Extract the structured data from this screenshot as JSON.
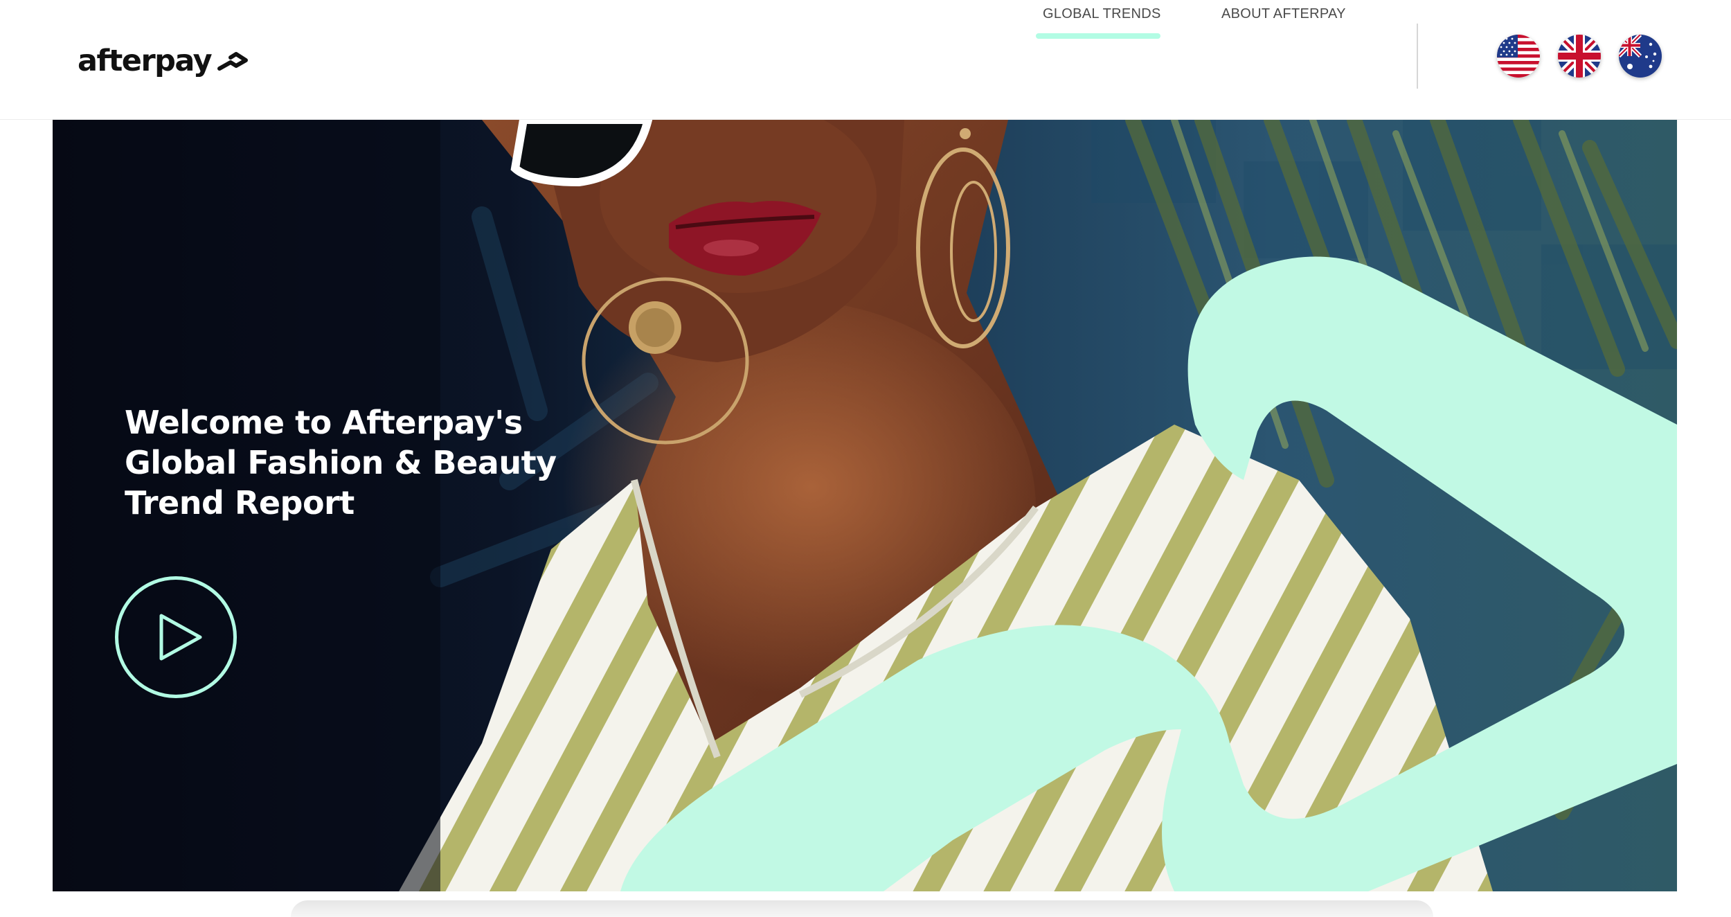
{
  "brand": {
    "name": "afterpay",
    "mark_icon": "afterpay-arrows-icon",
    "accent_color": "#b2fce4"
  },
  "nav": {
    "items": [
      {
        "label": "GLOBAL TRENDS",
        "active": true
      },
      {
        "label": "ABOUT AFTERPAY",
        "active": false
      }
    ]
  },
  "regions": [
    {
      "icon": "us-flag-icon"
    },
    {
      "icon": "uk-flag-icon"
    },
    {
      "icon": "australia-flag-icon"
    }
  ],
  "hero": {
    "title_lines": [
      "Welcome to Afterpay's",
      "Global Fashion & Beauty",
      "Trend Report"
    ],
    "play_icon": "play-icon",
    "image": "photo of woman in striped top with hoop earrings and sunglasses"
  }
}
